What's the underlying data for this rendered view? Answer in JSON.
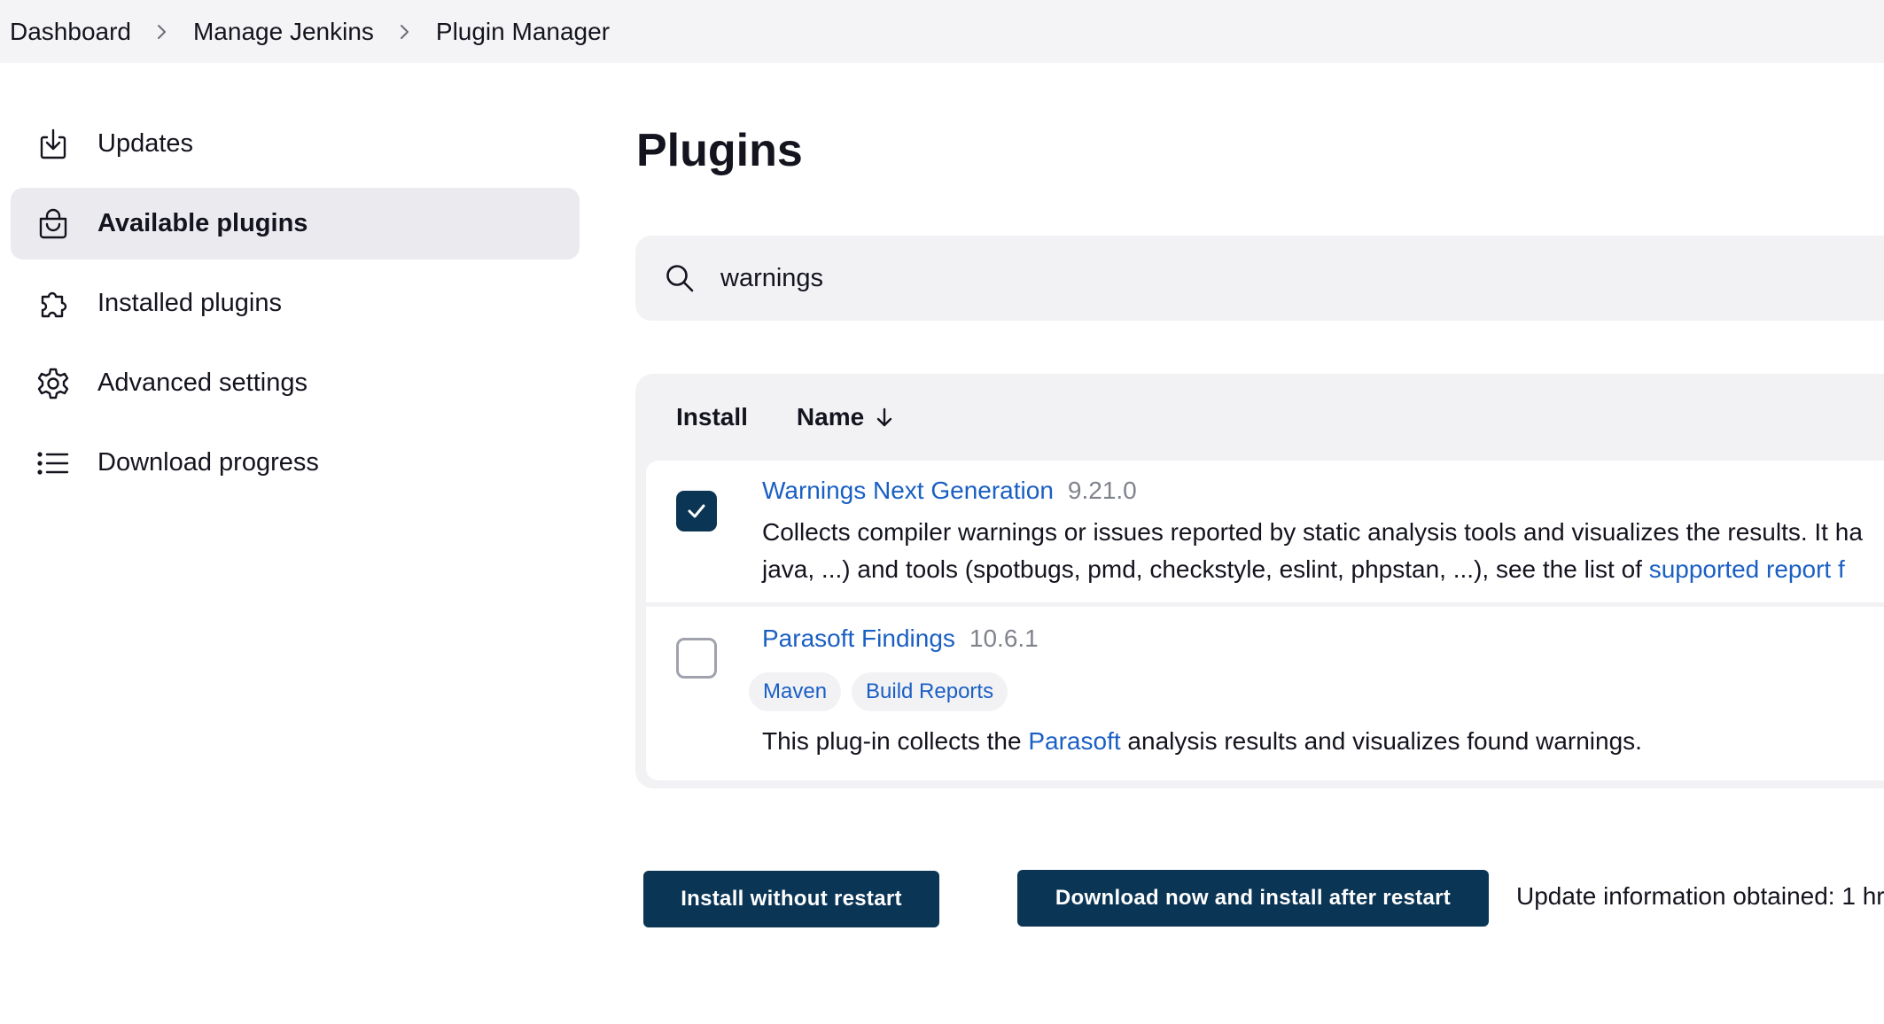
{
  "breadcrumb": {
    "items": [
      "Dashboard",
      "Manage Jenkins",
      "Plugin Manager"
    ]
  },
  "sidebar": {
    "items": [
      {
        "label": "Updates",
        "icon": "download-icon"
      },
      {
        "label": "Available plugins",
        "icon": "shopping-bag-icon",
        "active": true
      },
      {
        "label": "Installed plugins",
        "icon": "puzzle-icon"
      },
      {
        "label": "Advanced settings",
        "icon": "gear-icon"
      },
      {
        "label": "Download progress",
        "icon": "list-icon"
      }
    ]
  },
  "main": {
    "title": "Plugins",
    "search": {
      "value": "warnings",
      "icon": "search-icon"
    },
    "table": {
      "col_install": "Install",
      "col_name": "Name",
      "sort_icon": "arrow-down-icon",
      "rows": [
        {
          "name": "Warnings Next Generation",
          "version": "9.21.0",
          "checked": true,
          "desc_line1": "Collects compiler warnings or issues reported by static analysis tools and visualizes the results. It ha",
          "desc_line2_text": "java, ...) and tools (spotbugs, pmd, checkstyle, eslint, phpstan, ...), see the list of ",
          "desc_line2_link": "supported report f"
        },
        {
          "name": "Parasoft Findings",
          "version": "10.6.1",
          "checked": false,
          "tags": [
            "Maven",
            "Build Reports"
          ],
          "desc_before": "This plug-in collects the ",
          "desc_link": "Parasoft",
          "desc_after": " analysis results and visualizes found warnings."
        }
      ]
    },
    "buttons": {
      "install_without_restart": "Install without restart",
      "download_after_restart": "Download now and install after restart"
    },
    "update_info": "Update information obtained: 1 hr"
  },
  "colors": {
    "accent": "#0b3555",
    "link": "#1a5fc3",
    "panel": "#f2f2f5"
  }
}
